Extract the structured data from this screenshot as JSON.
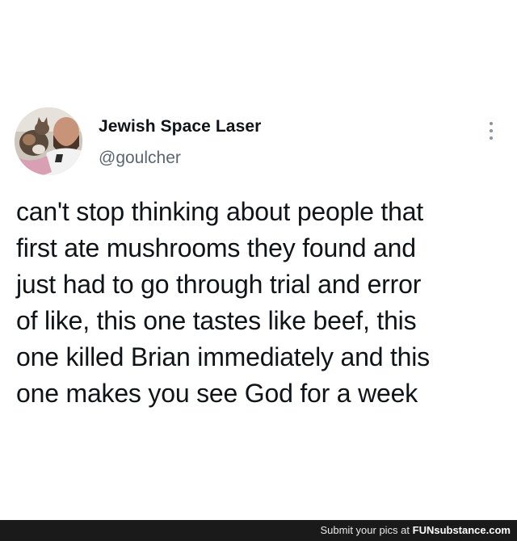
{
  "tweet": {
    "display_name": "Jewish Space Laser",
    "handle": "@goulcher",
    "text": "can't stop thinking about people that\nfirst ate mushrooms they found and\njust had to go through trial and error\nof like, this one tastes like beef, this\none killed Brian immediately and this\none makes you see God for a week",
    "more_icon": "more-vertical-icon"
  },
  "footer": {
    "prefix": "Submit your pics at ",
    "brand": "FUNsubstance.com"
  },
  "colors": {
    "background": "#ffffff",
    "text": "#0f1419",
    "handle": "#5b6670",
    "footer_bg": "#1a1a1a"
  }
}
